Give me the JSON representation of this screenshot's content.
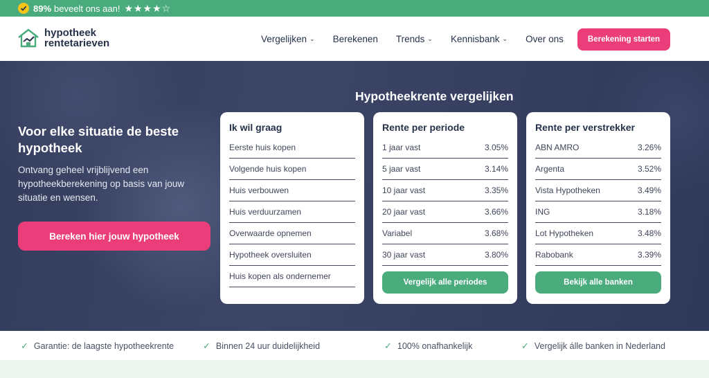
{
  "topbar": {
    "percentage": "89%",
    "text": "beveelt ons aan!",
    "stars": "★★★★☆"
  },
  "logo": {
    "line1": "hypotheek",
    "line2": "rentetarieven"
  },
  "nav": {
    "items": [
      {
        "label": "Vergelijken",
        "has_dropdown": true
      },
      {
        "label": "Berekenen",
        "has_dropdown": false
      },
      {
        "label": "Trends",
        "has_dropdown": true
      },
      {
        "label": "Kennisbank",
        "has_dropdown": true
      },
      {
        "label": "Over ons",
        "has_dropdown": false
      }
    ],
    "cta": "Berekening starten"
  },
  "hero": {
    "title": "Voor elke situatie de beste hypotheek",
    "subtitle": "Ontvang geheel vrijblijvend een hypotheekberekening op basis van jouw situatie en wensen.",
    "button": "Bereken hier jouw hypotheek",
    "compare_title": "Hypotheekrente vergelijken"
  },
  "cards": {
    "wish": {
      "title": "Ik wil graag",
      "items": [
        "Eerste huis kopen",
        "Volgende huis kopen",
        "Huis verbouwen",
        "Huis verduurzamen",
        "Overwaarde opnemen",
        "Hypotheek oversluiten",
        "Huis kopen als ondernemer"
      ]
    },
    "period": {
      "title": "Rente per periode",
      "rows": [
        {
          "label": "1 jaar vast",
          "value": "3.05%"
        },
        {
          "label": "5 jaar vast",
          "value": "3.14%"
        },
        {
          "label": "10 jaar vast",
          "value": "3.35%"
        },
        {
          "label": "20 jaar vast",
          "value": "3.66%"
        },
        {
          "label": "Variabel",
          "value": "3.68%"
        },
        {
          "label": "30 jaar vast",
          "value": "3.80%"
        }
      ],
      "button": "Vergelijk alle periodes"
    },
    "lender": {
      "title": "Rente per verstrekker",
      "rows": [
        {
          "label": "ABN AMRO",
          "value": "3.26%"
        },
        {
          "label": "Argenta",
          "value": "3.52%"
        },
        {
          "label": "Vista Hypotheken",
          "value": "3.49%"
        },
        {
          "label": "ING",
          "value": "3.18%"
        },
        {
          "label": "Lot Hypotheken",
          "value": "3.48%"
        },
        {
          "label": "Rabobank",
          "value": "3.39%"
        }
      ],
      "button": "Bekijk alle banken"
    }
  },
  "usps": [
    "Garantie: de laagste hypotheekrente",
    "Binnen 24 uur duidelijkheid",
    "100% onafhankelijk",
    "Vergelijk álle banken in Nederland"
  ],
  "colors": {
    "green": "#4aab7d",
    "pink": "#ea3d7a",
    "navy": "#343d5c"
  }
}
